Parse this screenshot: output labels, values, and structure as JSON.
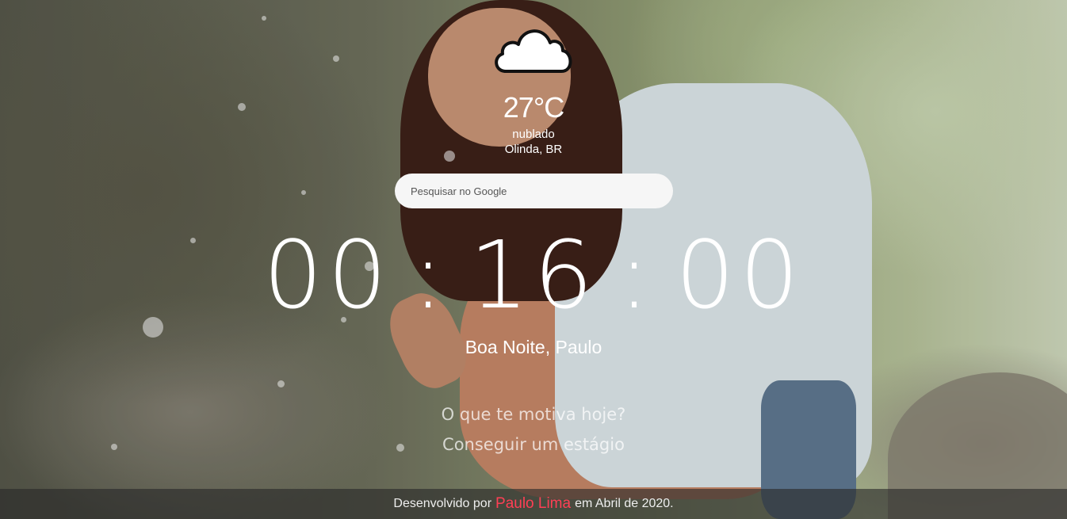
{
  "weather": {
    "icon": "cloud-icon",
    "temperature": "27°C",
    "description": "nublado",
    "location": "Olinda, BR"
  },
  "search": {
    "placeholder": "Pesquisar no Google"
  },
  "clock": {
    "hours": "00",
    "minutes": "16",
    "seconds": "00",
    "separator": ":"
  },
  "greeting": "Boa Noite, Paulo",
  "focus": {
    "question": "O que te motiva hoje?",
    "answer": "Conseguir um estágio"
  },
  "footer": {
    "prefix": "Desenvolvido por",
    "author": "Paulo Lima",
    "suffix": "em Abril de 2020.",
    "author_color": "#ff3f55"
  }
}
